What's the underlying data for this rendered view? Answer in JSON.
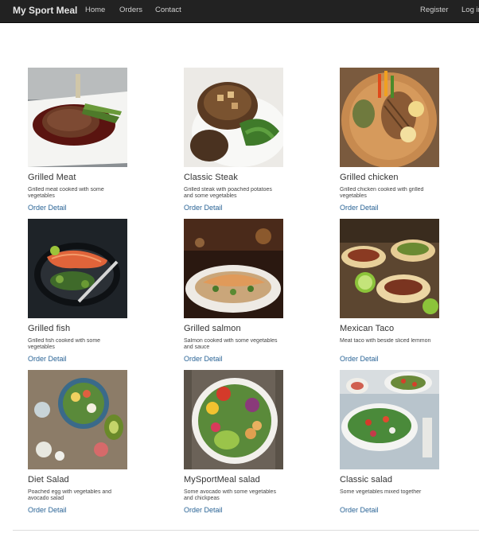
{
  "navbar": {
    "brand": "My Sport Meal",
    "links": [
      {
        "label": "Home"
      },
      {
        "label": "Orders"
      },
      {
        "label": "Contact"
      }
    ],
    "right_links": [
      {
        "label": "Register"
      },
      {
        "label": "Log in"
      }
    ]
  },
  "meals": [
    {
      "title": "Grilled Meat",
      "description": "Grilled meat cooked with some vegetables",
      "link": "Order Detail",
      "image": "grilled-meat-photo"
    },
    {
      "title": "Classic Steak",
      "description": "Grilled steak with poached potatoes and some vegetables",
      "link": "Order Detail",
      "image": "classic-steak-photo"
    },
    {
      "title": "Grilled chicken",
      "description": "Grilled chicken cooked with grilled vegetables",
      "link": "Order Detail",
      "image": "grilled-chicken-photo"
    },
    {
      "title": "Grilled fish",
      "description": "Grilled fish cooked with some vegetables",
      "link": "Order Detail",
      "image": "grilled-fish-photo"
    },
    {
      "title": "Grilled salmon",
      "description": "Salmon cooked with some vegetables and sauce",
      "link": "Order Detail",
      "image": "grilled-salmon-photo"
    },
    {
      "title": "Mexican Taco",
      "description": "Meat taco with beside sliced lemmon",
      "link": "Order Detail",
      "image": "mexican-taco-photo"
    },
    {
      "title": "Diet Salad",
      "description": "Poached egg with vegetables and avocado salad",
      "link": "Order Detail",
      "image": "diet-salad-photo"
    },
    {
      "title": "MySportMeal salad",
      "description": "Some avocado with some vegetables and chickpeas",
      "link": "Order Detail",
      "image": "mysportmeal-salad-photo"
    },
    {
      "title": "Classic salad",
      "description": "Some vegetables mixed together",
      "link": "Order Detail",
      "image": "classic-salad-photo"
    }
  ],
  "colors": {
    "navbar_bg": "#222222",
    "link": "#2a6496",
    "text": "#333333"
  }
}
